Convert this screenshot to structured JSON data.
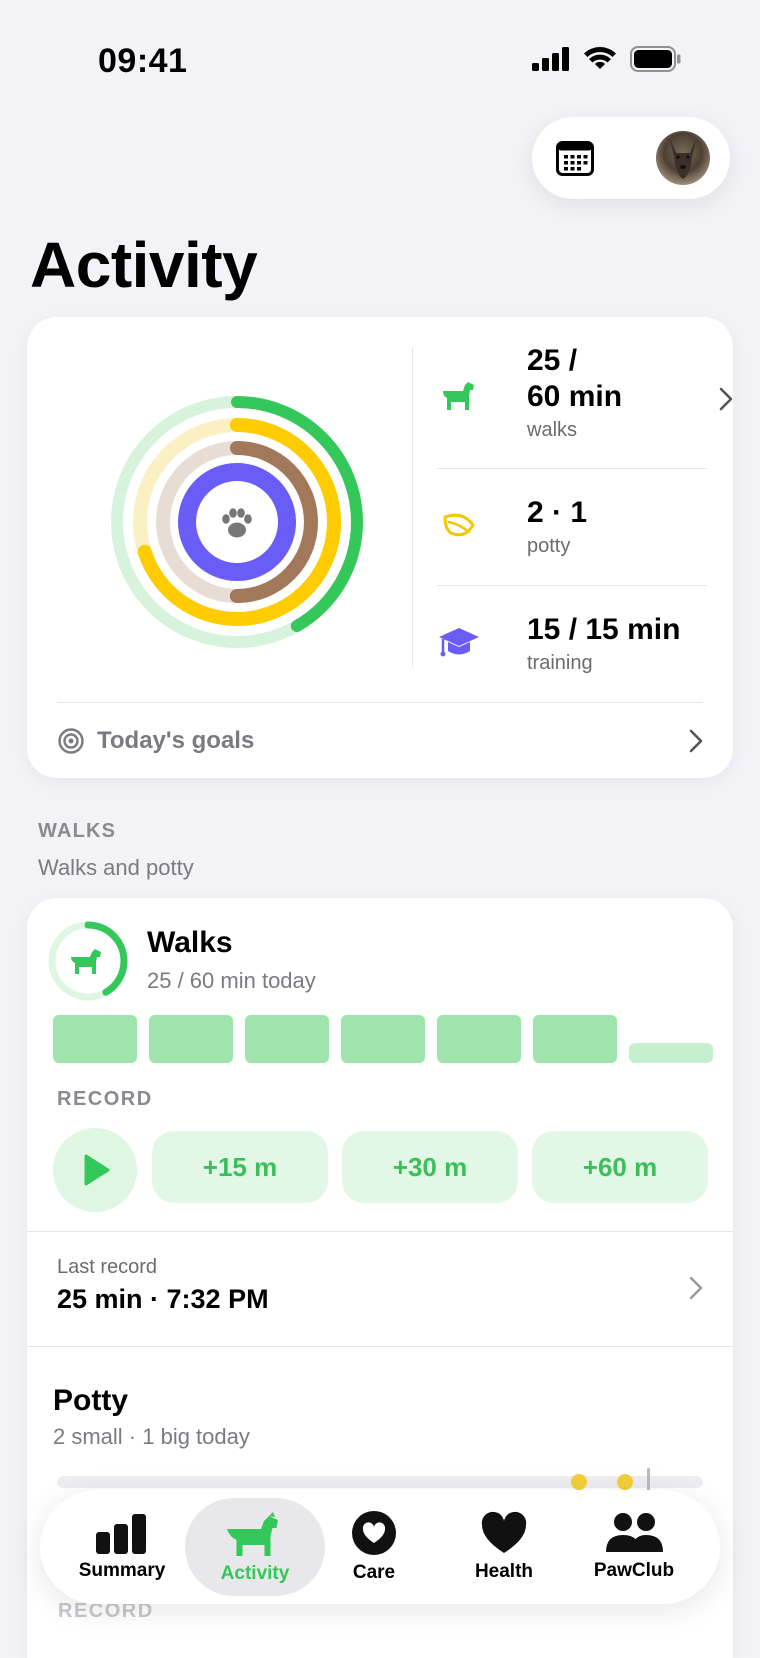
{
  "status_bar": {
    "time": "09:41"
  },
  "page": {
    "title": "Activity"
  },
  "summary": {
    "stats": [
      {
        "icon": "dog-icon",
        "value_line1": "25 /",
        "value_line2": "60 min",
        "label": "walks"
      },
      {
        "icon": "leaf-icon",
        "value_line1": "2 · 1",
        "label": "potty"
      },
      {
        "icon": "graduation-cap-icon",
        "value_line1": "15 / 15 min",
        "label": "training"
      }
    ],
    "goals_label": "Today's goals",
    "rings": {
      "walks": 0.4167,
      "potty": 0.7,
      "training": 1.0
    }
  },
  "walks_section": {
    "caption": "WALKS",
    "description": "Walks and potty"
  },
  "walks_card": {
    "title": "Walks",
    "subtitle": "25 / 60 min today",
    "progress": 0.4167,
    "record_caption": "RECORD",
    "buttons": [
      "+15 m",
      "+30 m",
      "+60 m"
    ],
    "last_record_label": "Last record",
    "last_record_value": "25 min · 7:32 PM"
  },
  "potty_card": {
    "title": "Potty",
    "subtitle": "2 small · 1 big today",
    "record_caption": "RECORD"
  },
  "tabbar": {
    "items": [
      {
        "label": "Summary",
        "icon": "bar-chart-icon"
      },
      {
        "label": "Activity",
        "icon": "dog-icon"
      },
      {
        "label": "Care",
        "icon": "heart-circle-icon"
      },
      {
        "label": "Health",
        "icon": "heart-icon"
      },
      {
        "label": "PawClub",
        "icon": "people-icon"
      }
    ],
    "active": "Activity"
  },
  "colors": {
    "green": "#34c759",
    "yellow": "#ffcc00",
    "brown": "#a2785a",
    "purple": "#6a5cf6"
  }
}
